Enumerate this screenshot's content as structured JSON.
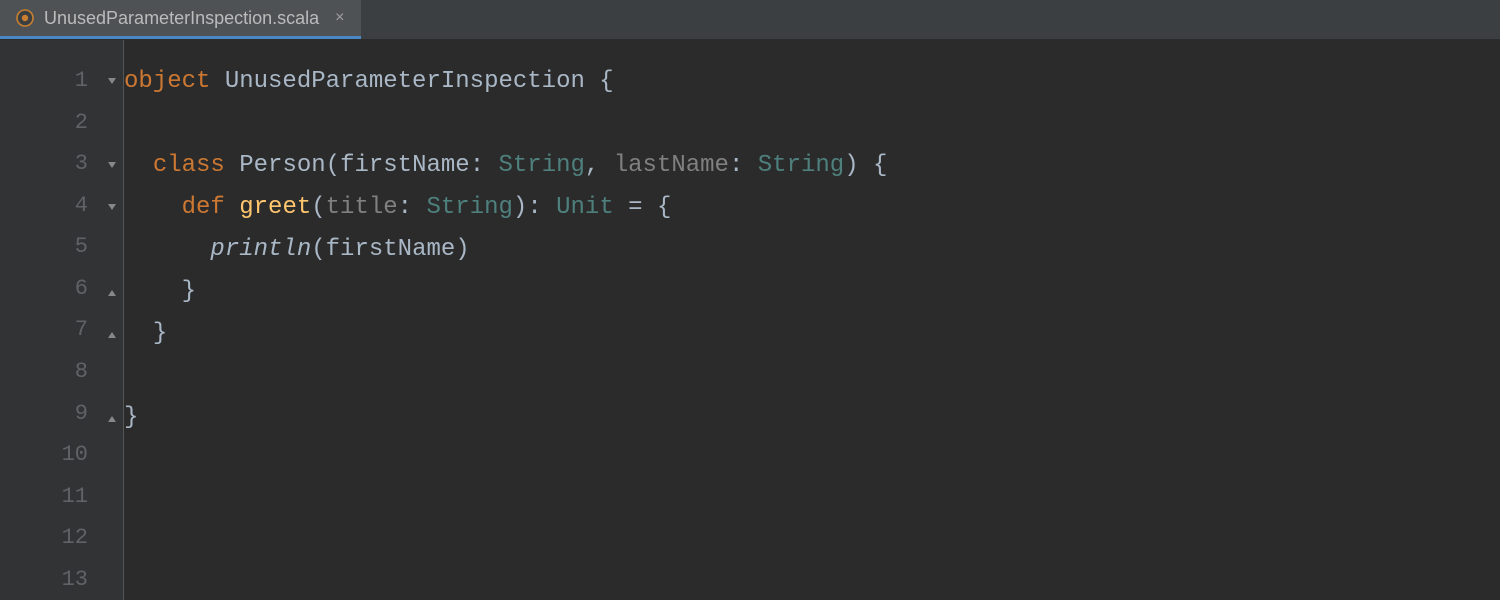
{
  "tab": {
    "filename": "UnusedParameterInspection.scala",
    "close_glyph": "×"
  },
  "gutter": {
    "lines": [
      "1",
      "2",
      "3",
      "4",
      "5",
      "6",
      "7",
      "8",
      "9",
      "10",
      "11",
      "12",
      "13"
    ]
  },
  "code": {
    "l1_kw": "object",
    "l1_ident": " UnusedParameterInspection ",
    "l1_brace": "{",
    "l3_indent": "  ",
    "l3_kw": "class",
    "l3_ident": " Person",
    "l3_open": "(",
    "l3_p1name": "firstName",
    "l3_colon1": ": ",
    "l3_p1type": "String",
    "l3_comma": ", ",
    "l3_p2name": "lastName",
    "l3_colon2": ": ",
    "l3_p2type": "String",
    "l3_close": ") ",
    "l3_brace": "{",
    "l4_indent": "    ",
    "l4_kw": "def",
    "l4_sp1": " ",
    "l4_method": "greet",
    "l4_open": "(",
    "l4_pname": "title",
    "l4_colon": ": ",
    "l4_ptype": "String",
    "l4_close": ")",
    "l4_rcolon": ": ",
    "l4_rtype": "Unit",
    "l4_eq": " = ",
    "l4_brace": "{",
    "l5_indent": "      ",
    "l5_call": "println",
    "l5_open": "(",
    "l5_arg": "firstName",
    "l5_close": ")",
    "l6_indent": "    ",
    "l6_brace": "}",
    "l7_indent": "  ",
    "l7_brace": "}",
    "l9_brace": "}"
  }
}
